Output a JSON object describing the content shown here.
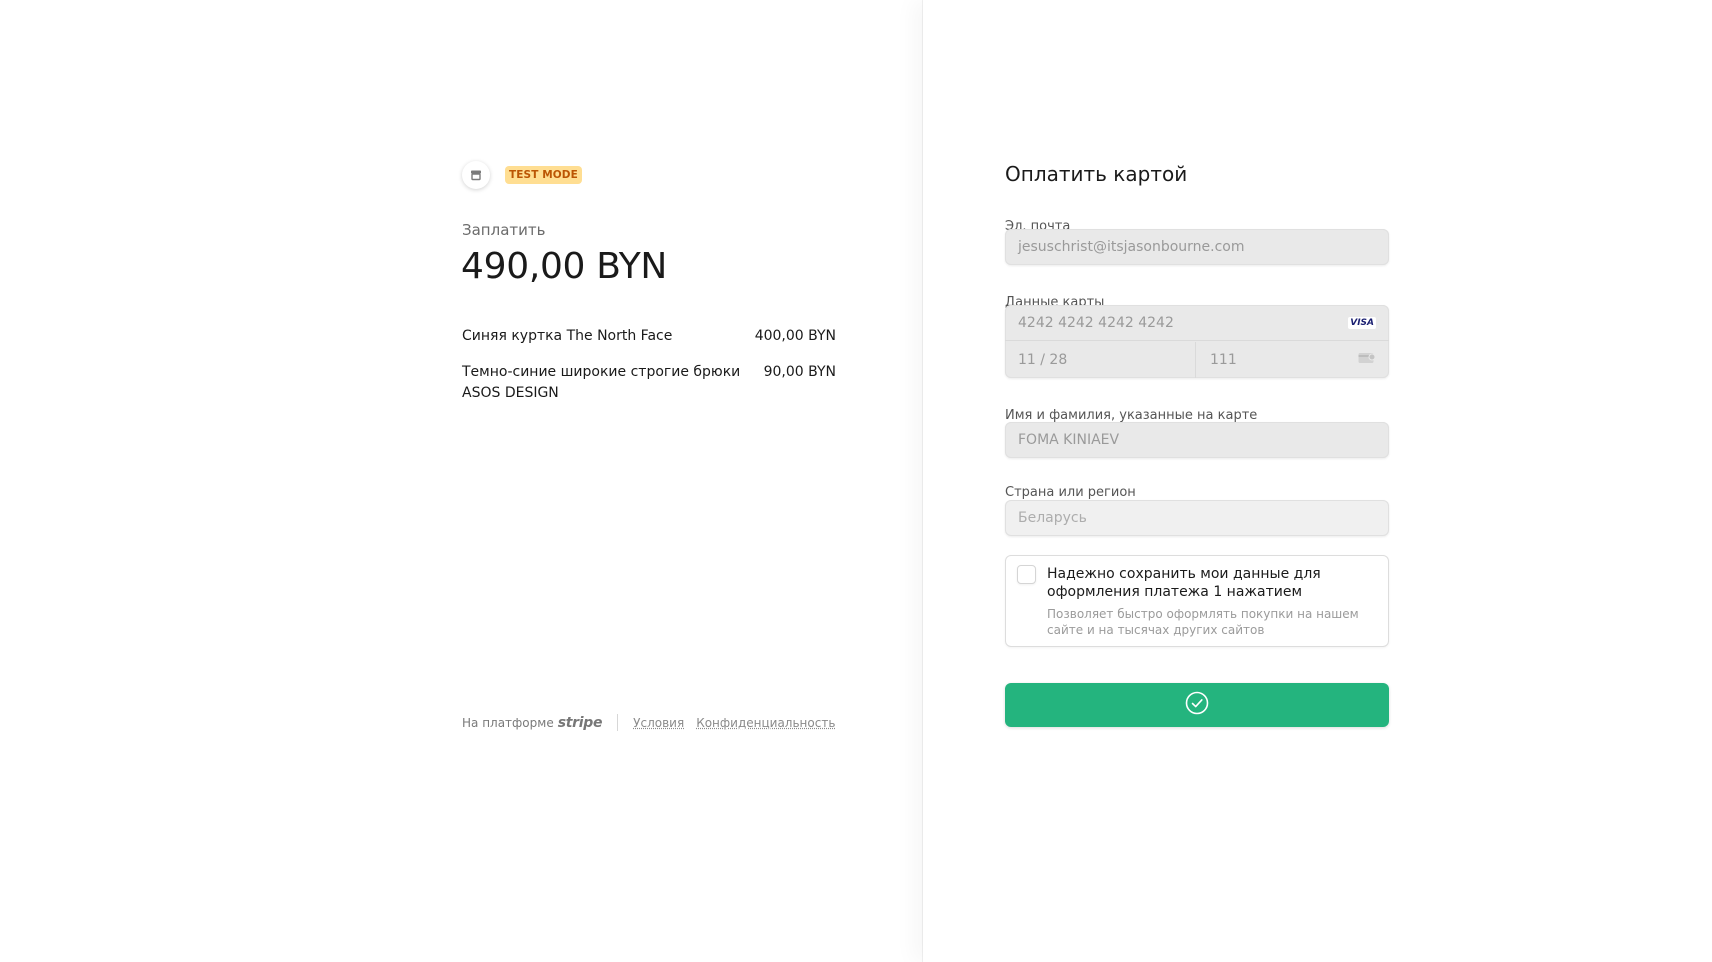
{
  "summary": {
    "test_badge": "TEST MODE",
    "pay_label": "Заплатить",
    "total": "490,00 BYN",
    "items": [
      {
        "name": "Синяя куртка The North Face",
        "price": "400,00 BYN"
      },
      {
        "name": "Темно-синие широкие строгие брюки ASOS DESIGN",
        "price": "90,00 BYN"
      }
    ]
  },
  "footer": {
    "powered_by": "На платформе",
    "brand": "stripe",
    "terms": "Условия",
    "privacy": "Конфиденциальность"
  },
  "form": {
    "title": "Оплатить картой",
    "email_label": "Эл. почта",
    "email_value": "jesuschrist@itsjasonbourne.com",
    "card_label": "Данные карты",
    "card_number": "4242 4242 4242 4242",
    "card_brand": "VISA",
    "card_expiry": "11 / 28",
    "card_cvc": "111",
    "name_label": "Имя и фамилия, указанные на карте",
    "name_value": "FOMA KINIAEV",
    "country_label": "Страна или регион",
    "country_value": "Беларусь",
    "save_title": "Надежно сохранить мои данные для оформления платежа 1 нажатием",
    "save_desc": "Позволяет быстро оформлять покупки на нашем сайте и на тысячах других сайтов"
  },
  "pay_button_state": "success-checkmark",
  "colors": {
    "accent_green": "#24b47e",
    "test_badge_bg": "#ffde92",
    "test_badge_text": "#bb5504"
  },
  "icons": {
    "merchant_logo": "store-icon",
    "card_brand": "visa-icon",
    "cvc": "card-back-icon",
    "pay_button": "check-circle-icon"
  }
}
